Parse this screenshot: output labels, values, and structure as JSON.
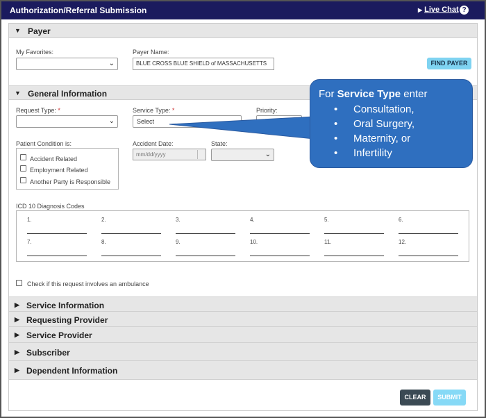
{
  "topbar": {
    "title": "Authorization/Referral Submission",
    "live_chat": "Live Chat",
    "help": "?"
  },
  "payer": {
    "header": "Payer",
    "favorites_label": "My Favorites:",
    "favorites_value": "",
    "payer_name_label": "Payer Name:",
    "payer_name_value": "BLUE CROSS BLUE SHIELD of MASSACHUSETTS",
    "find_button": "FIND PAYER"
  },
  "general": {
    "header": "General Information",
    "request_type_label": "Request Type:",
    "service_type_label": "Service Type:",
    "service_type_value": "Select",
    "priority_label": "Priority:",
    "required_mark": "*",
    "patient_condition_label": "Patient Condition is:",
    "conditions": [
      "Accident Related",
      "Employment Related",
      "Another Party is Responsible"
    ],
    "accident_date_label": "Accident Date:",
    "accident_date_placeholder": "mm/dd/yyyy",
    "state_label": "State:",
    "icd_label": "ICD 10 Diagnosis Codes",
    "icd_numbers": [
      "1.",
      "2.",
      "3.",
      "4.",
      "5.",
      "6.",
      "7.",
      "8.",
      "9.",
      "10.",
      "11.",
      "12."
    ],
    "ambulance_label": "Check if this request involves an ambulance"
  },
  "collapsed_sections": [
    "Service Information",
    "Requesting Provider",
    "Service Provider",
    "Subscriber",
    "Dependent Information"
  ],
  "footer": {
    "clear": "CLEAR",
    "submit": "SUBMIT"
  },
  "callout": {
    "prefix": "For ",
    "bold": "Service Type",
    "suffix": " enter",
    "items": [
      "Consultation,",
      "Oral Surgery,",
      "Maternity, or",
      "Infertility"
    ]
  },
  "colors": {
    "topbar": "#1b1b5e",
    "callout": "#2f6fbf",
    "find_button": "#7fd3f1",
    "clear_button": "#3b4a54",
    "submit_button": "#86d9f6"
  }
}
